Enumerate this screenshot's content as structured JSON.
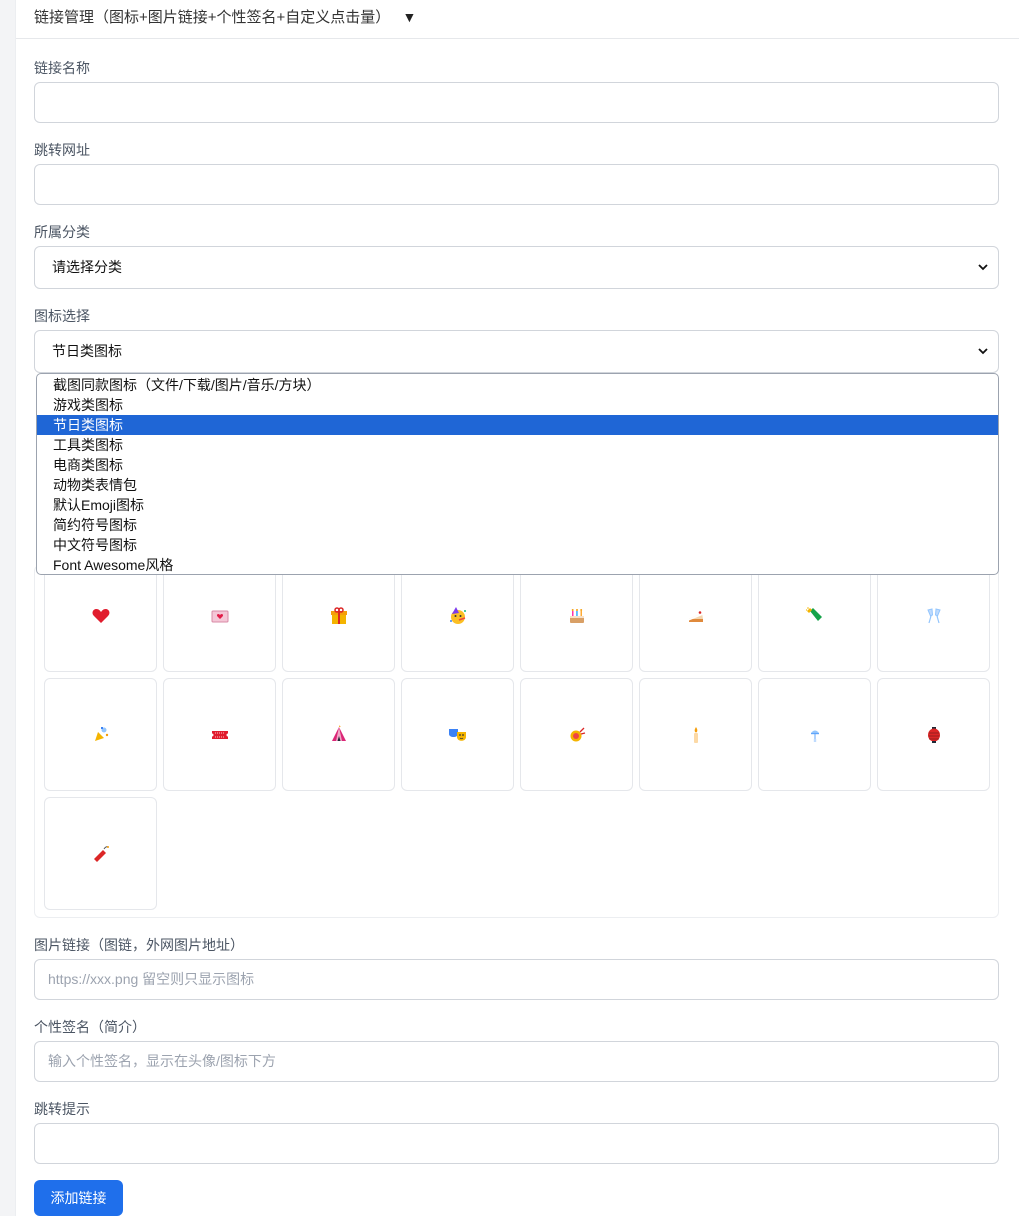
{
  "header": {
    "title": "链接管理（图标+图片链接+个性签名+自定义点击量）",
    "toggle": "▼"
  },
  "form": {
    "name_label": "链接名称",
    "name_value": "",
    "url_label": "跳转网址",
    "url_value": "",
    "category_label": "所属分类",
    "category_selected": "请选择分类",
    "icon_label": "图标选择",
    "icon_selected": "节日类图标",
    "icon_options": [
      "截图同款图标（文件/下载/图片/音乐/方块）",
      "游戏类图标",
      "节日类图标",
      "工具类图标",
      "电商类图标",
      "动物类表情包",
      "默认Emoji图标",
      "简约符号图标",
      "中文符号图标",
      "Font Awesome风格"
    ],
    "selected_option_index": 2,
    "icons": [
      "heart-icon",
      "love-letter-icon",
      "gift-icon",
      "party-face-icon",
      "birthday-cake-icon",
      "cake-slice-icon",
      "champagne-icon",
      "clinking-glasses-icon",
      "confetti-icon",
      "ticket-icon",
      "circus-tent-icon",
      "theater-masks-icon",
      "fireworks-icon",
      "candle-icon",
      "wind-chime-icon",
      "lantern-icon",
      "firecracker-icon"
    ],
    "image_label": "图片链接（图链，外网图片地址）",
    "image_placeholder": "https://xxx.png 留空则只显示图标",
    "signature_label": "个性签名（简介）",
    "signature_placeholder": "输入个性签名，显示在头像/图标下方",
    "tip_label": "跳转提示",
    "tip_value": "",
    "submit_label": "添加链接"
  },
  "colors": {
    "primary": "#1f6feb",
    "selected_option": "#1f66d6",
    "border": "#d1d5db"
  }
}
